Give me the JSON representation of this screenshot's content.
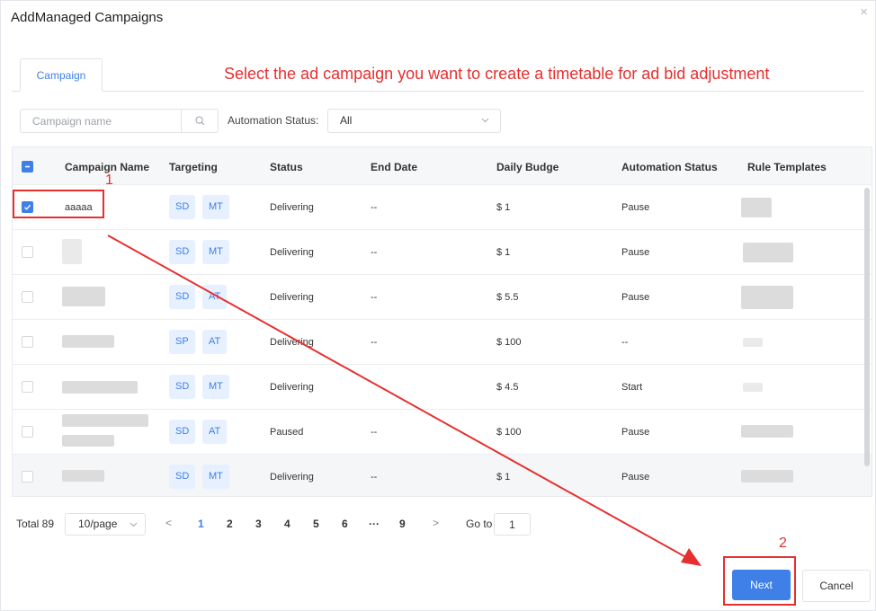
{
  "dialog": {
    "title": "AddManaged Campaigns",
    "close_glyph": "×"
  },
  "tabs": [
    {
      "label": "Campaign"
    }
  ],
  "instruction": "Select the ad campaign you want to create a timetable for ad bid adjustment",
  "filters": {
    "search_placeholder": "Campaign name",
    "automation_label": "Automation Status:",
    "automation_value": "All"
  },
  "table": {
    "columns": [
      "Campaign Name",
      "Targeting",
      "Status",
      "End Date",
      "Daily Budge",
      "Automation Status",
      "Rule Templates"
    ],
    "rows": [
      {
        "name": "aaaaa",
        "tags": [
          "SD",
          "MT"
        ],
        "status": "Delivering",
        "end_date": "--",
        "budget": "$ 1",
        "automation": "Pause",
        "checked": true
      },
      {
        "name": "",
        "tags": [
          "SD",
          "MT"
        ],
        "status": "Delivering",
        "end_date": "--",
        "budget": "$ 1",
        "automation": "Pause",
        "checked": false
      },
      {
        "name": "",
        "tags": [
          "SD",
          "AT"
        ],
        "status": "Delivering",
        "end_date": "--",
        "budget": "$ 5.5",
        "automation": "Pause",
        "checked": false
      },
      {
        "name": "",
        "tags": [
          "SP",
          "AT"
        ],
        "status": "Delivering",
        "end_date": "--",
        "budget": "$ 100",
        "automation": "--",
        "checked": false
      },
      {
        "name": "",
        "tags": [
          "SD",
          "MT"
        ],
        "status": "Delivering",
        "end_date": "",
        "budget": "$ 4.5",
        "automation": "Start",
        "checked": false
      },
      {
        "name": "",
        "tags": [
          "SD",
          "AT"
        ],
        "status": "Paused",
        "end_date": "--",
        "budget": "$ 100",
        "automation": "Pause",
        "checked": false
      },
      {
        "name": "",
        "tags": [
          "SD",
          "MT"
        ],
        "status": "Delivering",
        "end_date": "--",
        "budget": "$ 1",
        "automation": "Pause",
        "checked": false
      }
    ]
  },
  "pagination": {
    "total": "Total 89",
    "page_size": "10/page",
    "prev": "<",
    "pages": [
      "1",
      "2",
      "3",
      "4",
      "5",
      "6",
      "···",
      "9"
    ],
    "next": ">",
    "goto_label": "Go to",
    "goto_value": "1",
    "current_page": 1
  },
  "footer": {
    "next_label": "Next",
    "cancel_label": "Cancel"
  },
  "annotations": {
    "step1": "1",
    "step2": "2"
  },
  "colors": {
    "accent": "#3f7fe8",
    "annotation": "#e62f2f",
    "tag_bg": "#e7f0ff"
  },
  "icons": {
    "search": "search-icon",
    "chevron": "chevron-down-icon",
    "close": "close-icon"
  }
}
